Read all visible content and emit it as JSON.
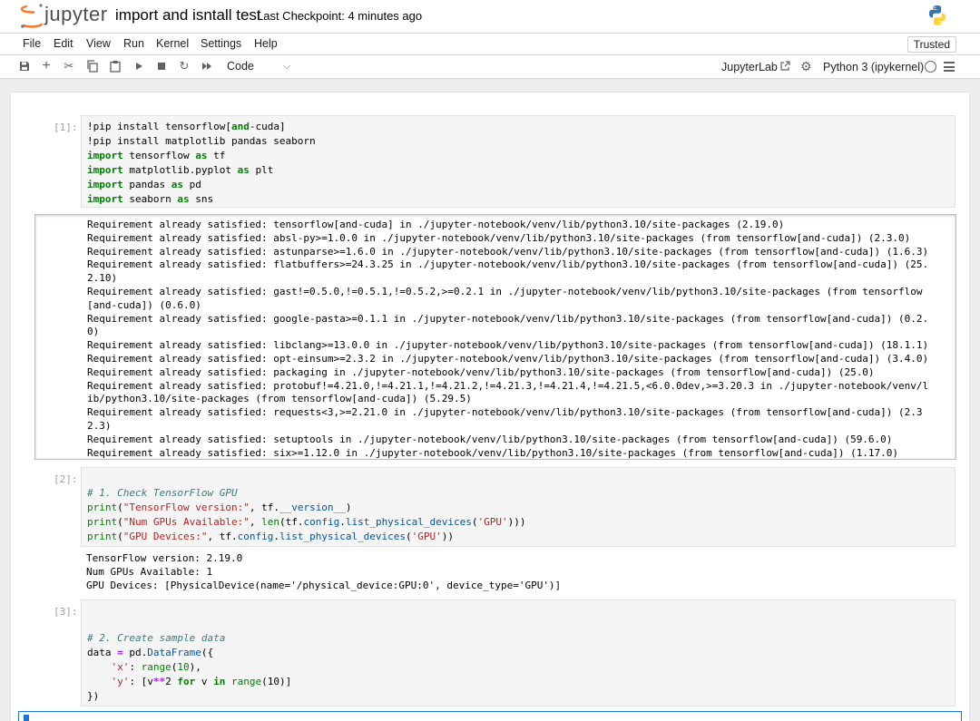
{
  "header": {
    "logo_text": "jupyter",
    "notebook_title": "import and isntall test",
    "checkpoint": "Last Checkpoint: 4 minutes ago"
  },
  "menu": {
    "items": [
      "File",
      "Edit",
      "View",
      "Run",
      "Kernel",
      "Settings",
      "Help"
    ],
    "trusted": "Trusted"
  },
  "toolbar": {
    "cell_type": "Code",
    "jupyterlab_label": "JupyterLab",
    "kernel_name": "Python 3 (ipykernel)"
  },
  "cells": [
    {
      "prompt": "[1]:",
      "code_lines": [
        "!pip install tensorflow[and-cuda]",
        "!pip install matplotlib pandas seaborn",
        "import tensorflow as tf",
        "import matplotlib.pyplot as plt",
        "import pandas as pd",
        "import seaborn as sns"
      ],
      "output_lines": [
        "Requirement already satisfied: tensorflow[and-cuda] in ./jupyter-notebook/venv/lib/python3.10/site-packages (2.19.0)",
        "Requirement already satisfied: absl-py>=1.0.0 in ./jupyter-notebook/venv/lib/python3.10/site-packages (from tensorflow[and-cuda]) (2.3.0)",
        "Requirement already satisfied: astunparse>=1.6.0 in ./jupyter-notebook/venv/lib/python3.10/site-packages (from tensorflow[and-cuda]) (1.6.3)",
        "Requirement already satisfied: flatbuffers>=24.3.25 in ./jupyter-notebook/venv/lib/python3.10/site-packages (from tensorflow[and-cuda]) (25.",
        "2.10)",
        "Requirement already satisfied: gast!=0.5.0,!=0.5.1,!=0.5.2,>=0.2.1 in ./jupyter-notebook/venv/lib/python3.10/site-packages (from tensorflow",
        "[and-cuda]) (0.6.0)",
        "Requirement already satisfied: google-pasta>=0.1.1 in ./jupyter-notebook/venv/lib/python3.10/site-packages (from tensorflow[and-cuda]) (0.2.",
        "0)",
        "Requirement already satisfied: libclang>=13.0.0 in ./jupyter-notebook/venv/lib/python3.10/site-packages (from tensorflow[and-cuda]) (18.1.1)",
        "Requirement already satisfied: opt-einsum>=2.3.2 in ./jupyter-notebook/venv/lib/python3.10/site-packages (from tensorflow[and-cuda]) (3.4.0)",
        "Requirement already satisfied: packaging in ./jupyter-notebook/venv/lib/python3.10/site-packages (from tensorflow[and-cuda]) (25.0)",
        "Requirement already satisfied: protobuf!=4.21.0,!=4.21.1,!=4.21.2,!=4.21.3,!=4.21.4,!=4.21.5,<6.0.0dev,>=3.20.3 in ./jupyter-notebook/venv/l",
        "ib/python3.10/site-packages (from tensorflow[and-cuda]) (5.29.5)",
        "Requirement already satisfied: requests<3,>=2.21.0 in ./jupyter-notebook/venv/lib/python3.10/site-packages (from tensorflow[and-cuda]) (2.3",
        "2.3)",
        "Requirement already satisfied: setuptools in ./jupyter-notebook/venv/lib/python3.10/site-packages (from tensorflow[and-cuda]) (59.6.0)",
        "Requirement already satisfied: six>=1.12.0 in ./jupyter-notebook/venv/lib/python3.10/site-packages (from tensorflow[and-cuda]) (1.17.0)"
      ]
    },
    {
      "prompt": "[2]:",
      "code_lines": [
        "# 1. Check TensorFlow GPU",
        "print(\"TensorFlow version:\", tf.__version__)",
        "print(\"Num GPUs Available:\", len(tf.config.list_physical_devices('GPU')))",
        "print(\"GPU Devices:\", tf.config.list_physical_devices('GPU'))"
      ],
      "output_lines": [
        "TensorFlow version: 2.19.0",
        "Num GPUs Available: 1",
        "GPU Devices: [PhysicalDevice(name='/physical_device:GPU:0', device_type='GPU')]"
      ]
    },
    {
      "prompt": "[3]:",
      "code_lines": [
        "",
        "# 2. Create sample data",
        "data = pd.DataFrame({",
        "    'x': range(10),",
        "    'y': [v**2 for v in range(10)]",
        "})"
      ]
    }
  ],
  "colors": {
    "keyword": "#008000",
    "string": "#ba2121",
    "comment": "#3d7b7b",
    "active": "#1976d2",
    "jupyter_orange": "#f37726"
  }
}
